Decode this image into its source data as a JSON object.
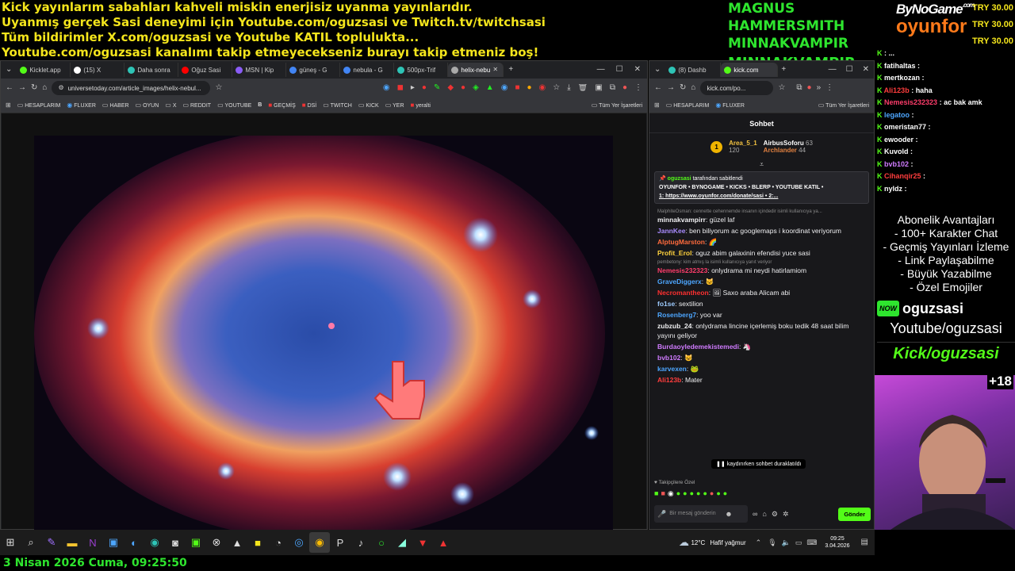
{
  "banner": {
    "lines": [
      "Kick yayınlarım sabahları kahveli miskin enerjisiz uyanma yayınlarıdır.",
      "Uyanmış gerçek Sasi deneyimi için Youtube.com/oguzsasi ve Twitch.tv/twitchsasi",
      "Tüm bildirimler X.com/oguzsasi ve Youtube KATIL toplulukta...",
      "Youtube.com/oguzsasi kanalımı takip etmeyecekseniz burayı takip etmeniz boş!"
    ]
  },
  "donors": [
    "MAGNUS HAMMERSMITH",
    "MINNAKVAMPIR",
    "MINNAKVAMPIR"
  ],
  "brand": {
    "top": "ByNoGame",
    "dotcom": ".com",
    "bottom": "oyunfor"
  },
  "tries": [
    "TRY 30.00",
    "TRY 30.00",
    "TRY 30.00"
  ],
  "left_browser": {
    "tabs": [
      "Kicklet.app",
      "(15) X",
      "Daha sonra",
      "Oğuz Sasi",
      "MSN | Kip",
      "güneş - G",
      "nebula - G",
      "500px-Trif",
      "helix-nebu"
    ],
    "url": "universetoday.com/article_images/helix-nebul...",
    "bookmarks": [
      "HESAPLARIM",
      "FLUXER",
      "HABER",
      "OYUN",
      "X",
      "REDDIT",
      "YOUTUBE",
      "B",
      "GEÇMİŞ",
      "DSİ",
      "TWITCH",
      "KICK",
      "YER",
      "yeralti",
      "Tüm Yer İşaretleri"
    ]
  },
  "right_browser": {
    "tabs": [
      "(8) Dashb",
      "kick.com"
    ],
    "url": "kick.com/po...",
    "bookmarks": [
      "HESAPLARIM",
      "FLUXER",
      "Tüm Yer İşaretleri"
    ],
    "chat_title": "Sohbet",
    "leaderboard": {
      "first_name": "Area_5_1",
      "first_val": "120",
      "rank": "1",
      "second_name": "AirbusSoforu",
      "second_val": "63",
      "third_name": "Archlander",
      "third_val": "44"
    },
    "pinned": {
      "by_user": "oguzsasi",
      "by_text": "tarafından sabitlendi",
      "text": "OYUNFOR • BYNOGAME • KICKS • BLERP • YOUTUBE KATIL •",
      "link": "1: https://www.oyunfor.com/donate/sasi • 2:..."
    },
    "messages": [
      {
        "sys": "MalphiteOsman: cennette cehennemde insanın içindedir isimli kullanıcıya ya..."
      },
      {
        "user": "minnakvampirr",
        "color": "#efeff1",
        "text": "güzel laf"
      },
      {
        "user": "JannKee",
        "color": "#a98cff",
        "text": "ben biliyorum ac googlemaps i koordinat veriyorum"
      },
      {
        "user": "AlptugMarston",
        "color": "#ff6b3d",
        "text": "🌈"
      },
      {
        "user": "Profit_Erol",
        "color": "#ffd23d",
        "text": "oguz abim galaxinin efendisi yuce sasi"
      },
      {
        "sys": "pembetony: kim atmış la isimli kullanıcıya yanıt veriyor"
      },
      {
        "user": "Nemesis232323",
        "color": "#ff3d6b",
        "text": "onlydrama mi neydi hatirlamiom"
      },
      {
        "user": "GraveDiggerx",
        "color": "#4da6ff",
        "text": "🐱"
      },
      {
        "user": "Necromantheon",
        "color": "#ff3030",
        "text": "🖼 Saxo araba Alicam abi"
      },
      {
        "user": "fo1se",
        "color": "#9ecbff",
        "text": "sextilion"
      },
      {
        "user": "Rosenberg7",
        "color": "#4da6ff",
        "text": "yoo var"
      },
      {
        "user": "zubzub_24",
        "color": "#efeff1",
        "text": "onlydrama lincine içerlemiş boku tedik 48 saat bilim yayını geliyor"
      },
      {
        "user": "Burdaoyledemekistemedi",
        "color": "#d07bff",
        "text": "🦄"
      },
      {
        "user": "bvb102",
        "color": "#d07bff",
        "text": "😺"
      },
      {
        "user": "karvexen",
        "color": "#4da6ff",
        "text": "🐸"
      },
      {
        "user": "Ali123b",
        "color": "#ff3d3d",
        "text": "Mater"
      }
    ],
    "paused": "kaydırırken sohbet duraklatıldı",
    "follower_label": "Takipçilere Özel",
    "input_placeholder": "Bir mesaj gönderin",
    "send": "Gönder"
  },
  "overlay_chat": [
    {
      "user": "",
      "color": "#fff",
      "text": "..."
    },
    {
      "user": "fatihaltas",
      "color": "#fff",
      "text": ""
    },
    {
      "user": "mertkozan",
      "color": "#fff",
      "text": ""
    },
    {
      "user": "Ali123b",
      "color": "#ff3d3d",
      "text": "haha"
    },
    {
      "user": "Nemesis232323",
      "color": "#ff3d6b",
      "text": "ac bak amk"
    },
    {
      "user": "legatoo",
      "color": "#4da6ff",
      "text": ""
    },
    {
      "user": "omeristan77",
      "color": "#fff",
      "text": ""
    },
    {
      "user": "ewooder",
      "color": "#fff",
      "text": ""
    },
    {
      "user": "Kuvold",
      "color": "#fff",
      "text": ""
    },
    {
      "user": "bvb102",
      "color": "#d07bff",
      "text": ""
    },
    {
      "user": "Cihanqir25",
      "color": "#ff3d3d",
      "text": ""
    },
    {
      "user": "nyldz",
      "color": "#fff",
      "text": ""
    }
  ],
  "perks": [
    "Abonelik Avantajları",
    "- 100+ Karakter Chat",
    "- Geçmiş Yayınları İzleme",
    "- Link Paylaşabilme",
    "- Büyük Yazabilme",
    "- Özel Emojiler"
  ],
  "social": {
    "now": "NOW",
    "name": "oguzsasi",
    "youtube": "Youtube/oguzsasi",
    "kick": "Kick/oguzsasi",
    "age": "+18"
  },
  "taskbar": {
    "weather": "12°C",
    "weather_desc": "Hafif yağmur",
    "time": "09:25",
    "date": "3.04.2026"
  },
  "bottom_text": "3 Nisan 2026 Cuma, 09:25:50",
  "colors": {
    "kick_green": "#53fc18",
    "banner_yellow": "#f4e51c",
    "donor_green": "#2ee52e"
  }
}
